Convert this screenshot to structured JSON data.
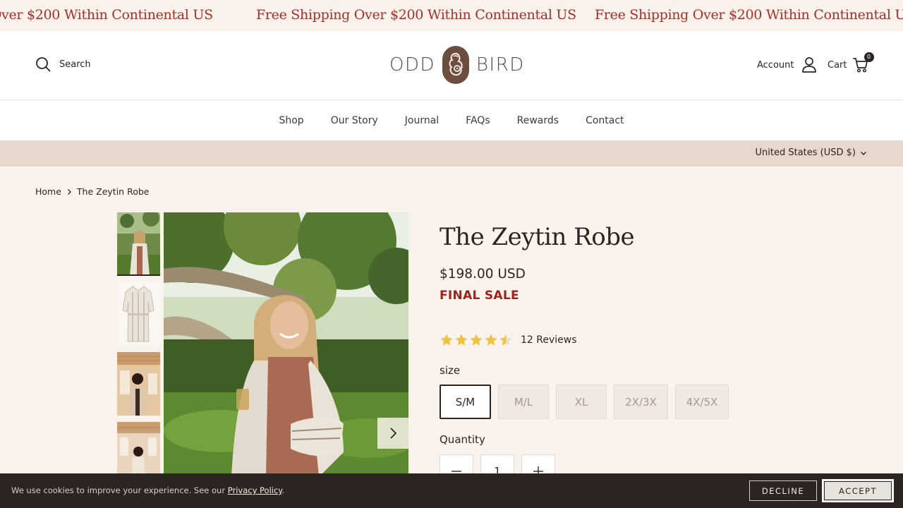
{
  "announcement": {
    "text": "Free Shipping Over $200 Within Continental US"
  },
  "header": {
    "search_label": "Search",
    "logo_left": "ODD",
    "logo_right": "BIRD",
    "account_label": "Account",
    "cart_label": "Cart",
    "cart_count": "0"
  },
  "nav": {
    "items": [
      "Shop",
      "Our Story",
      "Journal",
      "FAQs",
      "Rewards",
      "Contact"
    ]
  },
  "locale": {
    "label": "United States (USD $)"
  },
  "breadcrumb": {
    "home": "Home",
    "current": "The Zeytin Robe"
  },
  "product": {
    "title": "The Zeytin Robe",
    "price": "$198.00 USD",
    "badge": "FINAL SALE",
    "rating": 4.5,
    "reviews_label": "12 Reviews",
    "size_label": "size",
    "sizes": [
      "S/M",
      "M/L",
      "XL",
      "2X/3X",
      "4X/5X"
    ],
    "selected_size": "S/M",
    "quantity_label": "Quantity",
    "quantity": "1"
  },
  "cookie": {
    "text": "We use cookies to improve your experience. See our ",
    "link": "Privacy Policy",
    "suffix": ".",
    "decline": "DECLINE",
    "accept": "ACCEPT"
  },
  "colors": {
    "accent_red": "#a1221b",
    "star": "#f0c33c",
    "locale_bar": "#e8d8cb",
    "cookie_bg": "#2c2420"
  }
}
